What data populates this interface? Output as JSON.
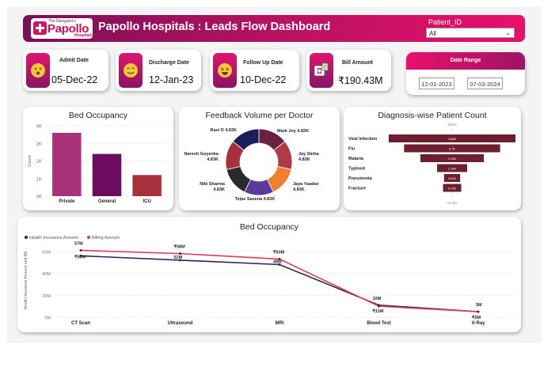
{
  "header": {
    "logo_top": "The Navigator's",
    "logo_main": "Papollo",
    "logo_sub": "Hospitals",
    "title": "Papollo Hospitals : Leads Flow Dashboard",
    "patient_id_label": "Patient_ID",
    "patient_id_value": "All"
  },
  "kpis": [
    {
      "label": "Admit Date",
      "value": "05-Dec-22",
      "icon": "dizzy-face-icon"
    },
    {
      "label": "Discharge Date",
      "value": "12-Jan-23",
      "icon": "smiling-face-icon"
    },
    {
      "label": "Follow Up Date",
      "value": "10-Dec-22",
      "icon": "laughing-face-icon"
    },
    {
      "label": "Bill Amount",
      "value": "₹190.43M",
      "icon": "hospital-bill-icon"
    }
  ],
  "date_range": {
    "label": "Date Range",
    "start": "12-01-2023",
    "end": "07-03-2024"
  },
  "colors": {
    "accent": "#e8106a",
    "deep": "#7a0f57",
    "health": "#2e2460",
    "billing": "#d9404f"
  },
  "bed_chart": {
    "title": "Bed Occupancy",
    "chart_data": {
      "type": "bar",
      "title": "Bed Occupancy",
      "ylabel": "Count",
      "categories": [
        "Private",
        "General",
        "ICU"
      ],
      "values": [
        3600,
        2400,
        1200
      ],
      "colors": [
        "#a7327a",
        "#6b0c5e",
        "#a8303c"
      ],
      "yticks": [
        "0K",
        "1K",
        "2K",
        "3K",
        "4K"
      ],
      "ylim": [
        0,
        4000
      ],
      "grid": true
    }
  },
  "feedback_chart": {
    "title": "Feedback Volume per Doctor",
    "chart_data": {
      "type": "pie",
      "title": "Feedback Volume per Doctor",
      "labels": [
        "Mark Joy 4.83K",
        "Jay Sinha 4.83K",
        "Jaya Yaadav 4.83K",
        "Tejas Saxena 4.83K",
        "Niki Sharma 4.83K",
        "Naresh Goyenka 4.83K",
        "Ravi D 4.83K"
      ],
      "values": [
        4830,
        4830,
        4830,
        4830,
        4830,
        4830,
        4830
      ],
      "colors": [
        "#6b2140",
        "#b03a48",
        "#f07f2e",
        "#5a3a9a",
        "#2a2a2a",
        "#a8303c",
        "#1a1f5c"
      ]
    }
  },
  "diagnosis_chart": {
    "title": "Diagnosis-wise Patient Count",
    "top_label": "100%",
    "bottom_label": "14.3%",
    "chart_data": {
      "type": "bar",
      "title": "Diagnosis-wise Patient Count",
      "categories": [
        "Viral Infection",
        "Flu",
        "Malaria",
        "Typhoid",
        "Pneumonia",
        "Fracture"
      ],
      "values": [
        4.88,
        3.7,
        2.44,
        1.16,
        0.62,
        0.7
      ],
      "value_labels": [
        "4.88K",
        "3.7K",
        "2.44K",
        "1.16K",
        "0.62K",
        "0.70K"
      ],
      "color": "#6b1f30"
    }
  },
  "line_chart": {
    "title": "Bed Occupancy",
    "ylabel": "Health Insurance Amount and Bill...",
    "chart_data": {
      "type": "line",
      "title": "Bed Occupancy",
      "ylabel": "Health Insurance Amount and Bill...",
      "categories": [
        "CT Scan",
        "Ultrasound",
        "MRI",
        "Blood Test",
        "X-Ray"
      ],
      "series": [
        {
          "name": "Health Insurance Amount",
          "values": [
            56,
            52,
            48,
            11,
            5
          ],
          "labels": [
            "₹56M",
            "52M",
            "48M",
            "₹11M",
            "₹5M"
          ],
          "color": "#2e2460"
        },
        {
          "name": "Billing Amount",
          "values": [
            61,
            58,
            53,
            10,
            5
          ],
          "labels": [
            "57M",
            "₹58M",
            "₹53M",
            "10M",
            "5M"
          ],
          "color": "#d9404f"
        }
      ],
      "yticks": [
        "0M",
        "20M",
        "40M",
        "60M"
      ],
      "ylim": [
        0,
        70
      ],
      "grid": true,
      "legend": "top-left"
    }
  }
}
